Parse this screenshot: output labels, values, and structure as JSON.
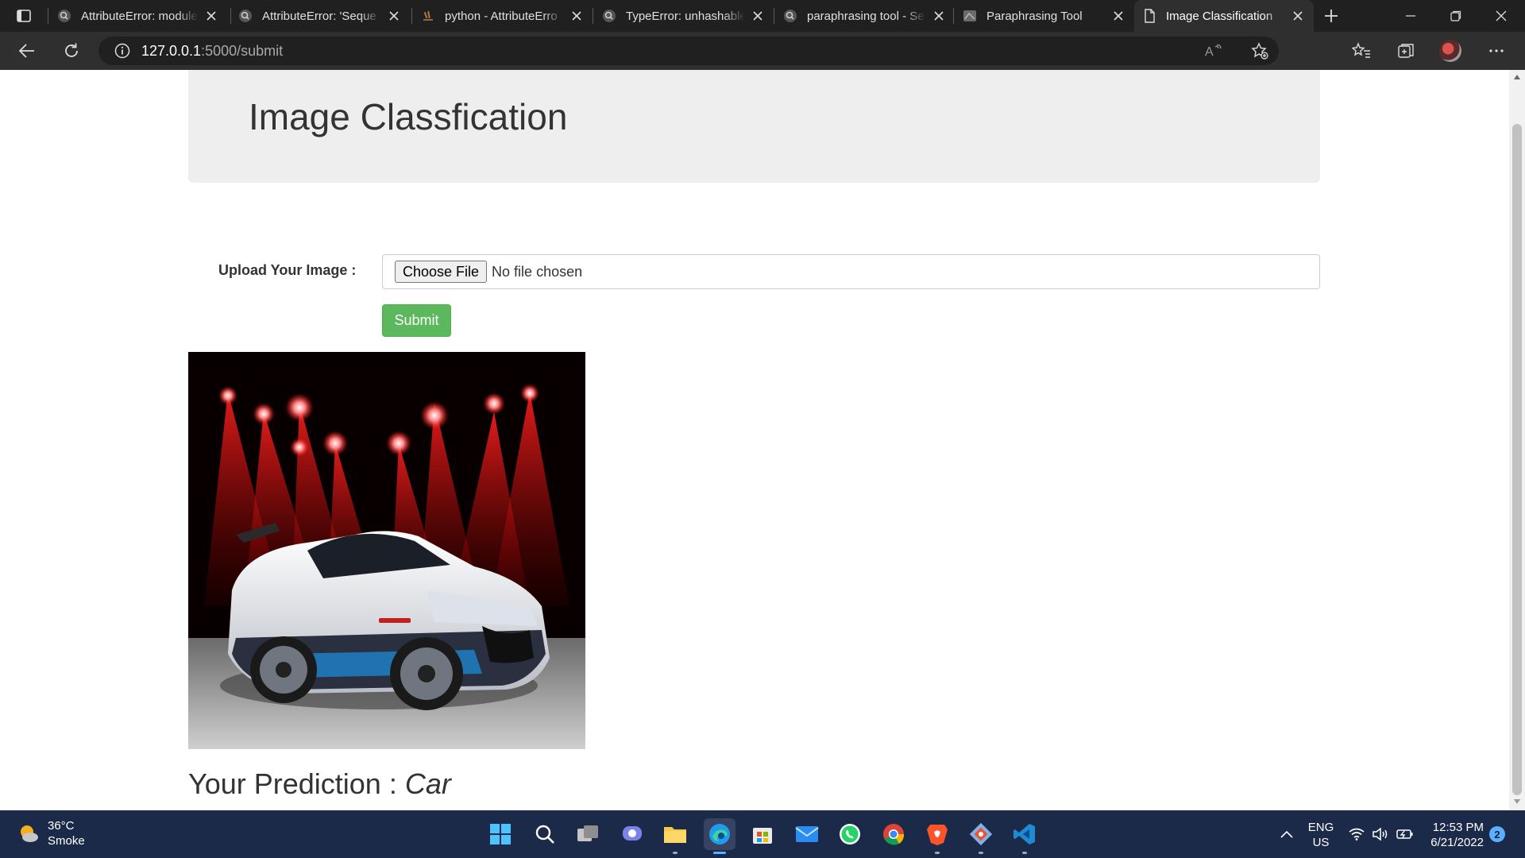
{
  "browser": {
    "tabs": [
      {
        "title": "AttributeError: module",
        "icon": "search-icon"
      },
      {
        "title": "AttributeError: 'Seque",
        "icon": "search-icon"
      },
      {
        "title": "python - AttributeErro",
        "icon": "stackoverflow-icon"
      },
      {
        "title": "TypeError: unhashable",
        "icon": "search-icon"
      },
      {
        "title": "paraphrasing tool - Se",
        "icon": "search-icon"
      },
      {
        "title": "Paraphrasing Tool",
        "icon": "site-icon"
      },
      {
        "title": "Image Classification",
        "icon": "page-icon",
        "active": true
      }
    ],
    "address": {
      "host": "127.0.0.1",
      "path": ":5000/submit"
    }
  },
  "page": {
    "heading": "Image Classfication",
    "upload_label": "Upload Your Image :",
    "choose_file_label": "Choose File",
    "no_file_text": "No file chosen",
    "submit_label": "Submit",
    "prediction_label": "Your Prediction : ",
    "prediction_value": "Car",
    "image_subject": "white sports car under red stage spotlights"
  },
  "colors": {
    "submit_green": "#5cb85c",
    "jumbotron_bg": "#eeeeee",
    "taskbar_bg": "#1c2a4a"
  },
  "taskbar": {
    "weather_temp": "36°C",
    "weather_desc": "Smoke",
    "apps": [
      "windows-start-icon",
      "search-icon",
      "task-view-icon",
      "teams-chat-icon",
      "file-explorer-icon",
      "edge-icon",
      "store-icon",
      "mail-icon",
      "whatsapp-icon",
      "chrome-icon",
      "brave-icon",
      "git-icon",
      "vscode-icon"
    ],
    "lang_line1": "ENG",
    "lang_line2": "US",
    "time": "12:53 PM",
    "date": "6/21/2022",
    "notification_count": "2"
  }
}
